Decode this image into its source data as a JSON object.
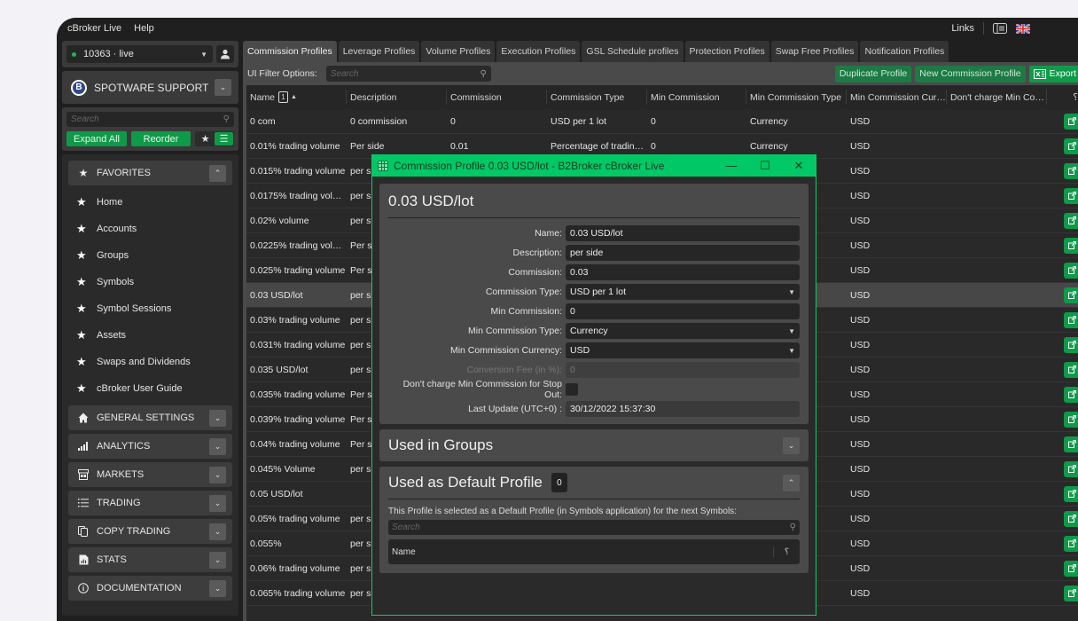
{
  "menubar": {
    "items": [
      "cBroker Live",
      "Help"
    ],
    "links_label": "Links"
  },
  "sidebar": {
    "account": {
      "label": "10363 · live",
      "status_color": "#1db954"
    },
    "brand": "SPOTWARE SUPPORT",
    "search_placeholder": "Search",
    "expand_all": "Expand All",
    "reorder": "Reorder",
    "favorites": {
      "label": "FAVORITES",
      "items": [
        "Home",
        "Accounts",
        "Groups",
        "Symbols",
        "Symbol Sessions",
        "Assets",
        "Swaps and Dividends",
        "cBroker User Guide"
      ]
    },
    "sections": [
      {
        "label": "GENERAL SETTINGS",
        "icon": "home-icon"
      },
      {
        "label": "ANALYTICS",
        "icon": "signal-bars-icon"
      },
      {
        "label": "MARKETS",
        "icon": "store-icon"
      },
      {
        "label": "TRADING",
        "icon": "list-icon"
      },
      {
        "label": "COPY TRADING",
        "icon": "copy-icon"
      },
      {
        "label": "STATS",
        "icon": "document-chart-icon"
      },
      {
        "label": "DOCUMENTATION",
        "icon": "info-icon"
      }
    ]
  },
  "tabs": [
    "Commission Profiles",
    "Leverage Profiles",
    "Volume Profiles",
    "Execution Profiles",
    "GSL Schedule profiles",
    "Protection Profiles",
    "Swap Free Profiles",
    "Notification Profiles"
  ],
  "active_tab": "Commission Profiles",
  "filter": {
    "label": "UI Filter Options:",
    "placeholder": "Search",
    "duplicate": "Duplicate Profile",
    "new": "New Commission Profile",
    "export": "Export"
  },
  "table": {
    "sort_index": "1",
    "columns": [
      "Name",
      "Description",
      "Commission",
      "Commission Type",
      "Min Commission",
      "Min Commission Type",
      "Min Commission Cur…",
      "Don't charge Min Co…"
    ],
    "rows": [
      {
        "name": "0 com",
        "description": "0 commission",
        "commission": "0",
        "type": "USD per 1 lot",
        "min": "0",
        "min_type": "Currency",
        "currency": "USD"
      },
      {
        "name": "0.01% trading volume",
        "description": "Per side",
        "commission": "0.01",
        "type": "Percentage of tradin…",
        "min": "0",
        "min_type": "Currency",
        "currency": "USD"
      },
      {
        "name": "0.015% trading volume",
        "description": "per s",
        "currency": "USD"
      },
      {
        "name": "0.0175% trading vol…",
        "description": "per s",
        "currency": "USD"
      },
      {
        "name": "0.02% volume",
        "description": "per s",
        "currency": "USD"
      },
      {
        "name": "0.0225% trading vol…",
        "description": "Per s",
        "currency": "USD"
      },
      {
        "name": "0.025% trading volume",
        "description": "Per s",
        "currency": "USD"
      },
      {
        "name": "0.03 USD/lot",
        "description": "per s",
        "currency": "USD",
        "selected": true
      },
      {
        "name": "0.03% trading volume",
        "description": "per s",
        "currency": "USD"
      },
      {
        "name": "0.031% trading volume",
        "description": "per s",
        "currency": "USD"
      },
      {
        "name": "0.035 USD/lot",
        "description": "per s",
        "currency": "USD"
      },
      {
        "name": "0.035% trading volume",
        "description": "Per s",
        "currency": "USD"
      },
      {
        "name": "0.039% trading volume",
        "description": "Per s",
        "currency": "USD"
      },
      {
        "name": "0.04% trading volume",
        "description": "Per s",
        "currency": "USD"
      },
      {
        "name": "0.045% Volume",
        "description": "per s",
        "currency": "USD"
      },
      {
        "name": "0.05 USD/lot",
        "description": "",
        "currency": "USD"
      },
      {
        "name": "0.05% trading volume",
        "description": "per s",
        "currency": "USD"
      },
      {
        "name": "0.055%",
        "description": "per s",
        "currency": "USD"
      },
      {
        "name": "0.06% trading volume",
        "description": "per s",
        "currency": "USD"
      },
      {
        "name": "0.065% trading volume",
        "description": "per s",
        "currency": "USD"
      }
    ]
  },
  "modal": {
    "title": "Commission Profile 0.03 USD/lot - B2Broker cBroker Live",
    "heading": "0.03 USD/lot",
    "fields": [
      {
        "label": "Name:",
        "value": "0.03 USD/lot",
        "kind": "text"
      },
      {
        "label": "Description:",
        "value": "per side",
        "kind": "text"
      },
      {
        "label": "Commission:",
        "value": "0.03",
        "kind": "text"
      },
      {
        "label": "Commission Type:",
        "value": "USD per 1 lot",
        "kind": "select"
      },
      {
        "label": "Min Commission:",
        "value": "0",
        "kind": "text"
      },
      {
        "label": "Min Commission Type:",
        "value": "Currency",
        "kind": "select"
      },
      {
        "label": "Min Commission Currency:",
        "value": "USD",
        "kind": "select"
      },
      {
        "label": "Conversion Fee (in %):",
        "value": "0",
        "kind": "disabled"
      },
      {
        "label": "Don't charge Min Commission for Stop Out:",
        "value": "",
        "kind": "checkbox",
        "checked": false
      },
      {
        "label": "Last Update (UTC+0) :",
        "value": "30/12/2022 15:37:30",
        "kind": "readonly"
      }
    ],
    "used_in_groups": "Used in Groups",
    "used_as_default": {
      "title": "Used as Default Profile",
      "count": "0",
      "description": "This Profile is selected as a Default Profile (in Symbols application) for the next Symbols:",
      "search_placeholder": "Search",
      "column": "Name"
    }
  },
  "colors": {
    "accent_green": "#0e9a48",
    "modal_title_green": "#00c866",
    "background": "#1f1f1f"
  }
}
